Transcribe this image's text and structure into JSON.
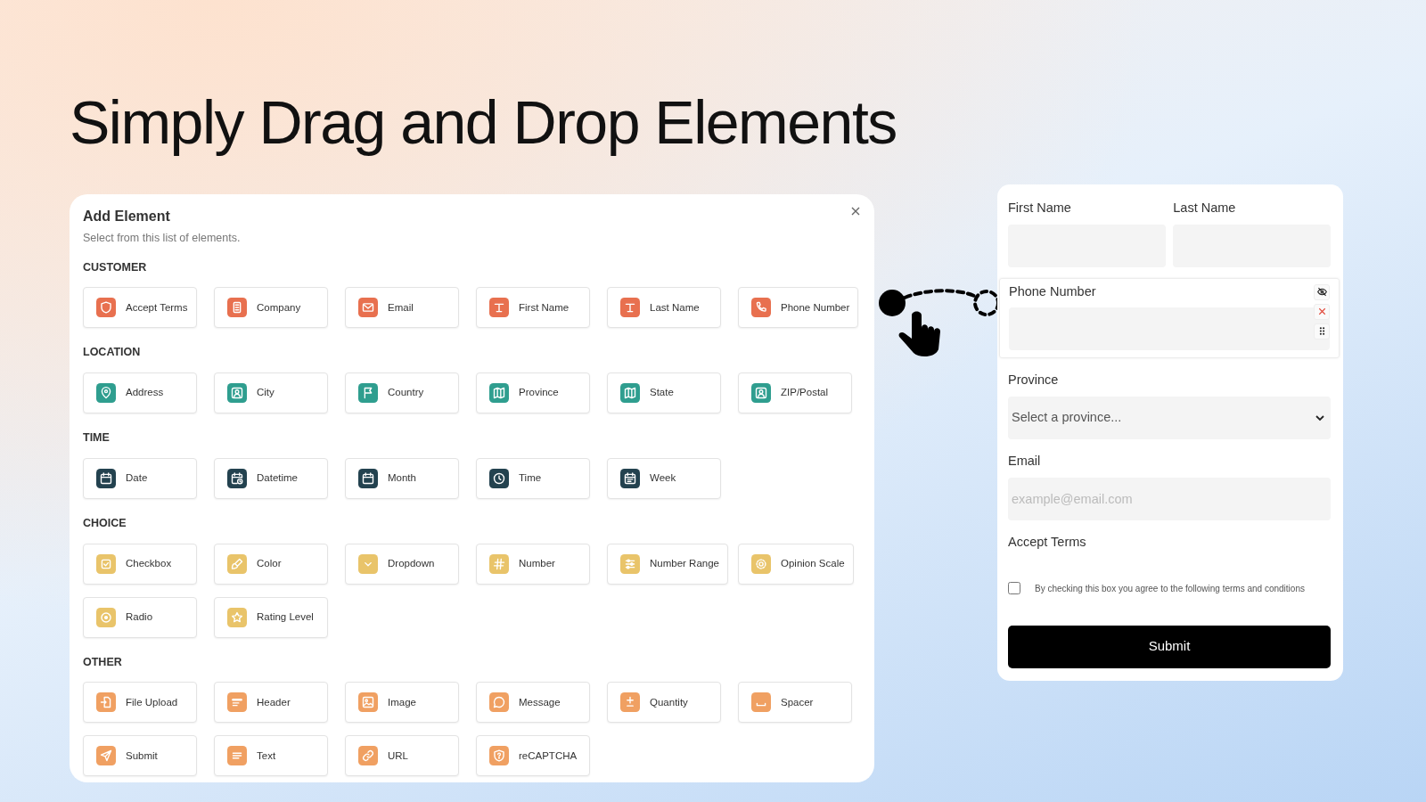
{
  "headline": "Simply Drag and Drop Elements",
  "panel": {
    "title": "Add Element",
    "subtitle": "Select from this list of elements.",
    "sections": [
      {
        "title": "CUSTOMER",
        "color": "#e8704f",
        "items": [
          {
            "label": "Accept Terms",
            "kind": "shield"
          },
          {
            "label": "Company",
            "kind": "building"
          },
          {
            "label": "Email",
            "kind": "envelope"
          },
          {
            "label": "First Name",
            "kind": "type"
          },
          {
            "label": "Last Name",
            "kind": "type"
          },
          {
            "label": "Phone Number",
            "kind": "phone"
          }
        ]
      },
      {
        "title": "LOCATION",
        "color": "#2f9e8f",
        "items": [
          {
            "label": "Address",
            "kind": "pin"
          },
          {
            "label": "City",
            "kind": "person"
          },
          {
            "label": "Country",
            "kind": "flag"
          },
          {
            "label": "Province",
            "kind": "map"
          },
          {
            "label": "State",
            "kind": "map"
          },
          {
            "label": "ZIP/Postal",
            "kind": "person"
          }
        ]
      },
      {
        "title": "TIME",
        "color": "#23424f",
        "items": [
          {
            "label": "Date",
            "kind": "calendar"
          },
          {
            "label": "Datetime",
            "kind": "calendarclock"
          },
          {
            "label": "Month",
            "kind": "calendar"
          },
          {
            "label": "Time",
            "kind": "clock"
          },
          {
            "label": "Week",
            "kind": "calendarlist"
          }
        ]
      },
      {
        "title": "CHOICE",
        "color": "#e9c46a",
        "items": [
          {
            "label": "Checkbox",
            "kind": "checksquare"
          },
          {
            "label": "Color",
            "kind": "brush"
          },
          {
            "label": "Dropdown",
            "kind": "chevron"
          },
          {
            "label": "Number",
            "kind": "hash"
          },
          {
            "label": "Number Range",
            "kind": "sliders"
          },
          {
            "label": "Opinion Scale",
            "kind": "gear"
          },
          {
            "label": "Radio",
            "kind": "radio"
          },
          {
            "label": "Rating Level",
            "kind": "star"
          }
        ]
      },
      {
        "title": "OTHER",
        "color": "#f0a062",
        "items": [
          {
            "label": "File Upload",
            "kind": "fileimport"
          },
          {
            "label": "Header",
            "kind": "heading"
          },
          {
            "label": "Image",
            "kind": "image"
          },
          {
            "label": "Message",
            "kind": "chat"
          },
          {
            "label": "Quantity",
            "kind": "plusminus"
          },
          {
            "label": "Spacer",
            "kind": "spacer"
          },
          {
            "label": "Submit",
            "kind": "send"
          },
          {
            "label": "Text",
            "kind": "lines"
          },
          {
            "label": "URL",
            "kind": "link"
          },
          {
            "label": "reCAPTCHA",
            "kind": "shieldquestion"
          }
        ]
      }
    ]
  },
  "form": {
    "rows": [
      {
        "kind": "pair",
        "fields": [
          {
            "label": "First Name"
          },
          {
            "label": "Last Name"
          }
        ]
      },
      {
        "kind": "text",
        "label": "Phone Number",
        "selected": true
      },
      {
        "kind": "select",
        "label": "Province",
        "placeholder": "Select a province..."
      },
      {
        "kind": "email",
        "label": "Email",
        "placeholder": "example@email.com"
      },
      {
        "kind": "checkbox",
        "label": "Accept Terms",
        "text": "By checking this box you agree to the following terms and conditions",
        "checked": false
      }
    ],
    "submit": "Submit"
  }
}
